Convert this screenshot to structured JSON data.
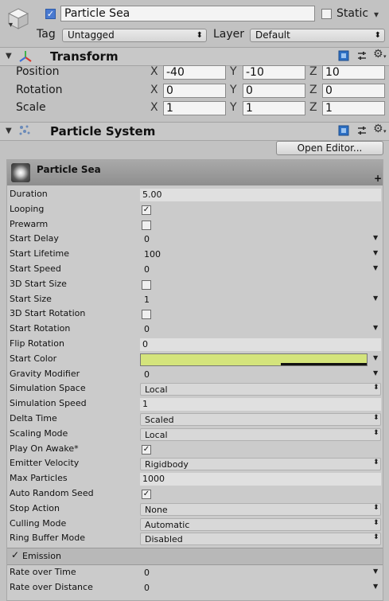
{
  "gameobject": {
    "active": true,
    "name": "Particle Sea",
    "static_label": "Static",
    "tag_label": "Tag",
    "tag_value": "Untagged",
    "layer_label": "Layer",
    "layer_value": "Default"
  },
  "transform": {
    "title": "Transform",
    "rows": [
      {
        "label": "Position",
        "x": "-40",
        "y": "-10",
        "z": "10"
      },
      {
        "label": "Rotation",
        "x": "0",
        "y": "0",
        "z": "0"
      },
      {
        "label": "Scale",
        "x": "1",
        "y": "1",
        "z": "1"
      }
    ],
    "axis": {
      "x": "X",
      "y": "Y",
      "z": "Z"
    }
  },
  "particle_system": {
    "title": "Particle System",
    "open_editor": "Open Editor...",
    "module_title": "Particle Sea",
    "add_symbol": "+",
    "start_color_hex": "#d4e47c",
    "properties": [
      {
        "label": "Duration",
        "value": "5.00",
        "kind": "field"
      },
      {
        "label": "Looping",
        "value": "checked",
        "kind": "check"
      },
      {
        "label": "Prewarm",
        "value": "unchecked",
        "kind": "check"
      },
      {
        "label": "Start Delay",
        "value": "0",
        "kind": "curve"
      },
      {
        "label": "Start Lifetime",
        "value": "100",
        "kind": "curve"
      },
      {
        "label": "Start Speed",
        "value": "0",
        "kind": "curve"
      },
      {
        "label": "3D Start Size",
        "value": "unchecked",
        "kind": "check"
      },
      {
        "label": "Start Size",
        "value": "1",
        "kind": "curve"
      },
      {
        "label": "3D Start Rotation",
        "value": "unchecked",
        "kind": "check"
      },
      {
        "label": "Start Rotation",
        "value": "0",
        "kind": "curve"
      },
      {
        "label": "Flip Rotation",
        "value": "0",
        "kind": "field"
      },
      {
        "label": "Start Color",
        "value": "",
        "kind": "color"
      },
      {
        "label": "Gravity Modifier",
        "value": "0",
        "kind": "curve"
      },
      {
        "label": "Simulation Space",
        "value": "Local",
        "kind": "dropdown"
      },
      {
        "label": "Simulation Speed",
        "value": "1",
        "kind": "field"
      },
      {
        "label": "Delta Time",
        "value": "Scaled",
        "kind": "dropdown"
      },
      {
        "label": "Scaling Mode",
        "value": "Local",
        "kind": "dropdown"
      },
      {
        "label": "Play On Awake*",
        "value": "checked",
        "kind": "check"
      },
      {
        "label": "Emitter Velocity",
        "value": "Rigidbody",
        "kind": "dropdown"
      },
      {
        "label": "Max Particles",
        "value": "1000",
        "kind": "field"
      },
      {
        "label": "Auto Random Seed",
        "value": "checked",
        "kind": "check"
      },
      {
        "label": "Stop Action",
        "value": "None",
        "kind": "dropdown"
      },
      {
        "label": "Culling Mode",
        "value": "Automatic",
        "kind": "dropdown"
      },
      {
        "label": "Ring Buffer Mode",
        "value": "Disabled",
        "kind": "dropdown"
      }
    ],
    "emission": {
      "label": "Emission",
      "enabled": true,
      "properties": [
        {
          "label": "Rate over Time",
          "value": "0"
        },
        {
          "label": "Rate over Distance",
          "value": "0"
        }
      ]
    }
  }
}
